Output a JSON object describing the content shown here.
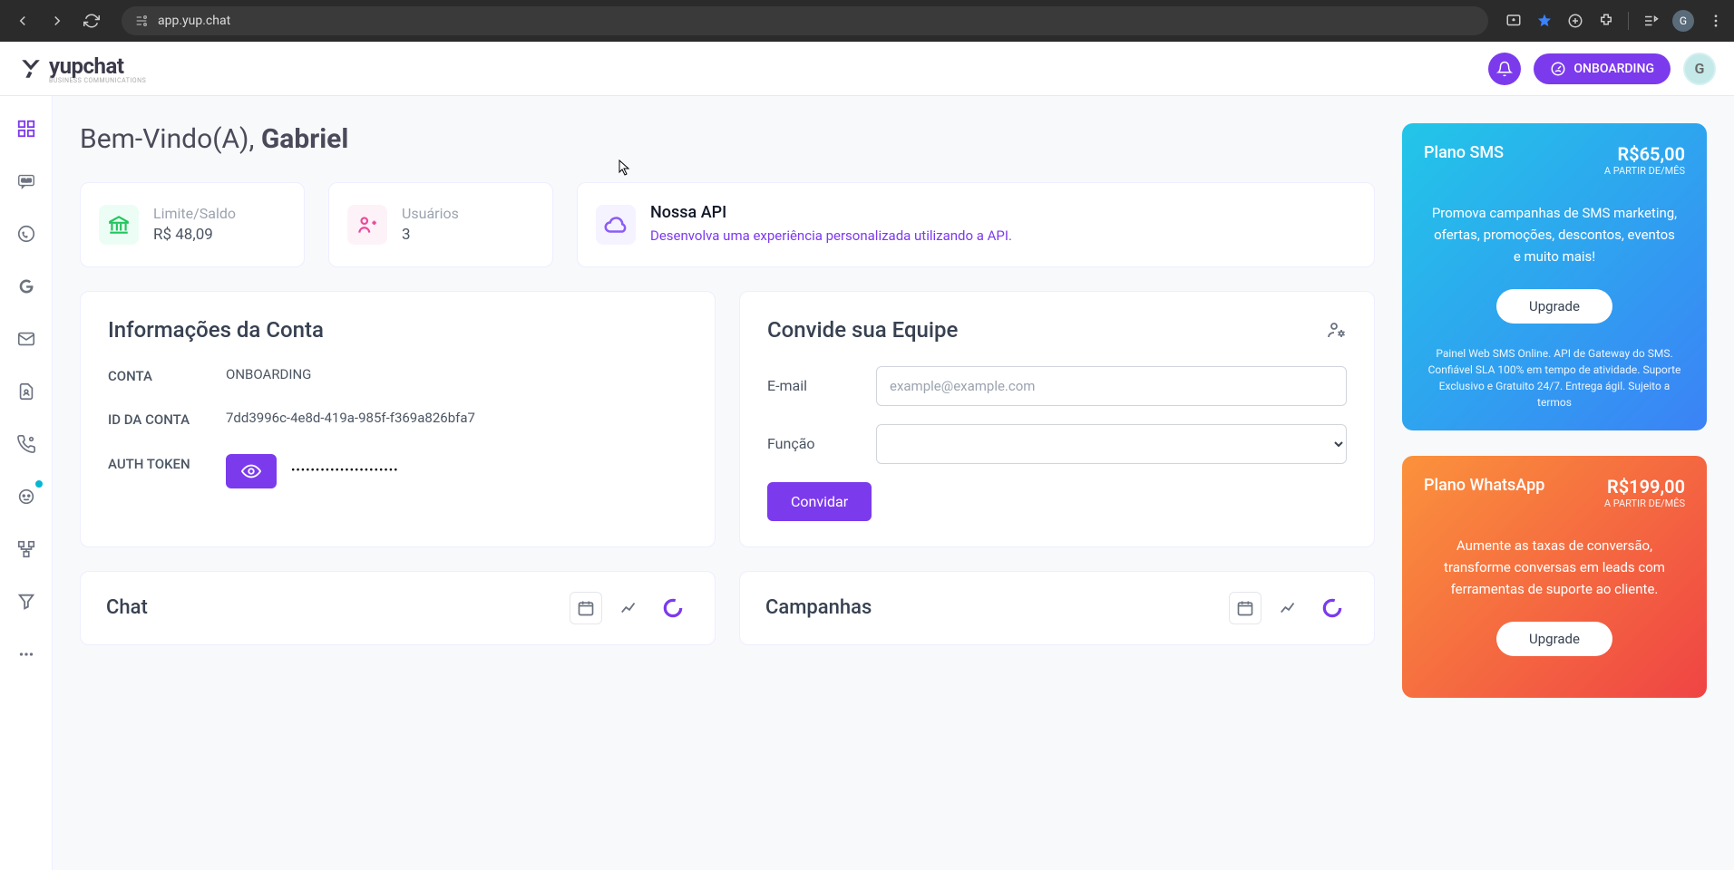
{
  "browser": {
    "url": "app.yup.chat",
    "avatar_letter": "G"
  },
  "header": {
    "brand": "yupchat",
    "brand_sub": "BUSINESS COMMUNICATIONS",
    "onboarding_label": "ONBOARDING",
    "avatar_letter": "G"
  },
  "welcome": {
    "prefix": "Bem-Vindo(A), ",
    "name": "Gabriel"
  },
  "summary": {
    "balance": {
      "label": "Limite/Saldo",
      "value": "R$ 48,09"
    },
    "users": {
      "label": "Usuários",
      "value": "3"
    },
    "api": {
      "title": "Nossa API",
      "desc": "Desenvolva uma experiência personalizada utilizando a API."
    }
  },
  "account_info": {
    "title": "Informações da Conta",
    "rows": {
      "account": {
        "label": "CONTA",
        "value": "ONBOARDING"
      },
      "account_id": {
        "label": "ID DA CONTA",
        "value": "7dd3996c-4e8d-419a-985f-f369a826bfa7"
      },
      "auth_token": {
        "label": "AUTH TOKEN",
        "value": "••••••••••••••••••••••"
      }
    }
  },
  "invite": {
    "title": "Convide sua Equipe",
    "email_label": "E-mail",
    "email_placeholder": "example@example.com",
    "role_label": "Função",
    "button": "Convidar"
  },
  "charts": {
    "chat": "Chat",
    "campaigns": "Campanhas"
  },
  "plans": {
    "sms": {
      "name": "Plano SMS",
      "price": "R$65,00",
      "per": "A PARTIR DE/MÊS",
      "desc": "Promova campanhas de SMS marketing, ofertas, promoções, descontos, eventos e muito mais!",
      "upgrade": "Upgrade",
      "footer": "Painel Web SMS Online. API de Gateway do SMS. Confiável SLA 100% em tempo de atividade. Suporte Exclusivo e Gratuito 24/7. Entrega ágil. Sujeito a termos"
    },
    "whatsapp": {
      "name": "Plano WhatsApp",
      "price": "R$199,00",
      "per": "A PARTIR DE/MÊS",
      "desc": "Aumente as taxas de conversão, transforme conversas em leads com ferramentas de suporte ao cliente.",
      "upgrade": "Upgrade"
    }
  }
}
